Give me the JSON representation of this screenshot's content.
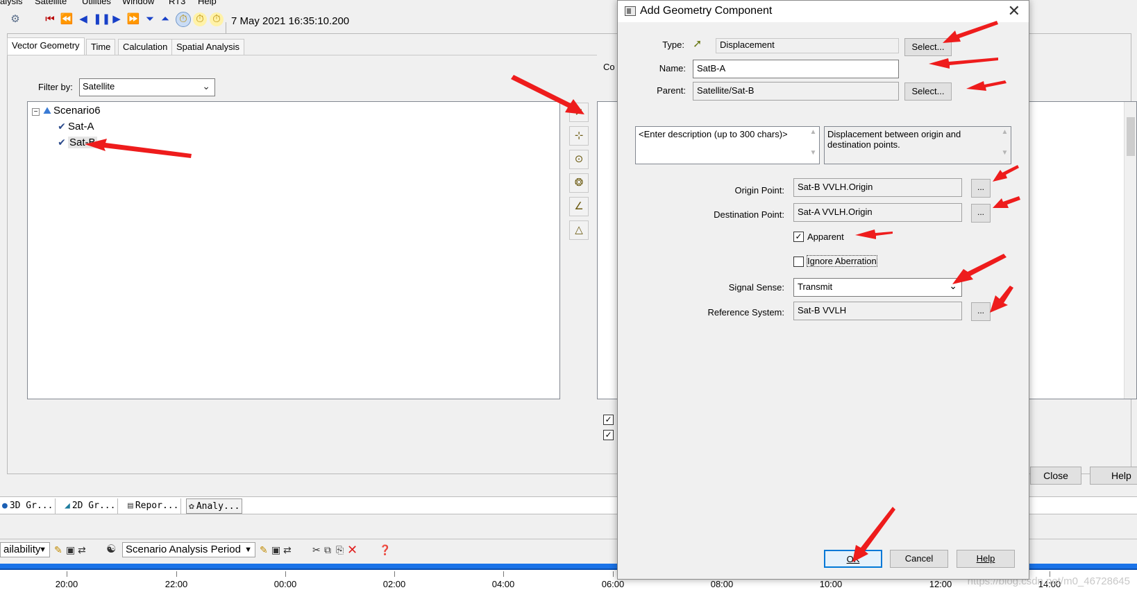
{
  "menu": [
    "alysis",
    "Satellite",
    "Utilities",
    "Window",
    "RT3",
    "Help"
  ],
  "toolbar": {
    "datetime": "7 May 2021 16:35:10.200",
    "icons": [
      "settings-icon",
      "reset-icon",
      "step-back-icon",
      "decrease-time-step-icon",
      "pause-icon",
      "play-icon",
      "step-forward-icon",
      "increase-time-step-icon",
      "real-time-icon",
      "x-real-time-icon",
      "animation-mode-icon"
    ]
  },
  "main": {
    "tabs": [
      "Vector Geometry",
      "Time",
      "Calculation",
      "Spatial Analysis"
    ],
    "filter": {
      "label": "Filter by:",
      "value": "Satellite"
    },
    "tree": {
      "root": "Scenario6",
      "children": [
        "Sat-A",
        "Sat-B"
      ]
    },
    "right_pane_label": "Co",
    "close_label": "Close",
    "help_label": "Help"
  },
  "window_tabs": [
    "3D Gr...",
    "2D Gr...",
    "Repor...",
    "Analy..."
  ],
  "time_toolbar": {
    "combo1": "ailability",
    "combo2": "Scenario Analysis Period"
  },
  "timeline": {
    "ticks": [
      "20:00",
      "22:00",
      "00:00",
      "02:00",
      "04:00",
      "06:00",
      "08:00",
      "10:00",
      "12:00",
      "14:00"
    ],
    "watermark": "https://blog.csdn.net/m0_46728645"
  },
  "dialog": {
    "title": "Add Geometry Component",
    "type_label": "Type:",
    "type_value": "Displacement",
    "select_label": "Select...",
    "name_label": "Name:",
    "name_value": "SatB-A",
    "parent_label": "Parent:",
    "parent_value": "Satellite/Sat-B",
    "description_placeholder": "<Enter description (up to 300 chars)>",
    "type_description": "Displacement between origin and destination points.",
    "origin_label": "Origin Point:",
    "origin_value": "Sat-B VVLH.Origin",
    "destination_label": "Destination Point:",
    "destination_value": "Sat-A VVLH.Origin",
    "ellipsis": "...",
    "apparent_label": "Apparent",
    "apparent_checked": true,
    "ignore_aberration_label": "Ignore Aberration",
    "ignore_aberration_checked": false,
    "signal_sense_label": "Signal Sense:",
    "signal_sense_value": "Transmit",
    "reference_system_label": "Reference System:",
    "reference_system_value": "Sat-B VVLH",
    "ok_label": "OK",
    "cancel_label": "Cancel",
    "help_label": "Help"
  },
  "colors": {
    "annotation_arrow": "#ee1c1c",
    "timeline_bar": "#1a73e8"
  }
}
